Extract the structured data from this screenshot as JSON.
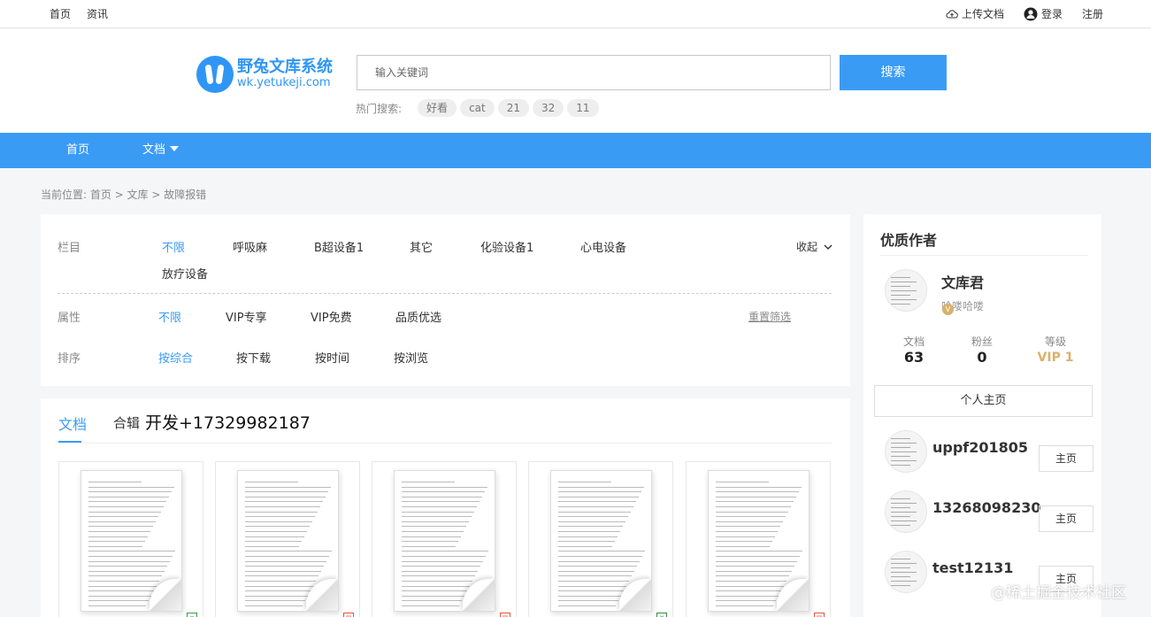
{
  "topbar": {
    "left_links": [
      "首页",
      "资讯"
    ],
    "upload": "上传文档",
    "login": "登录",
    "register": "注册"
  },
  "header": {
    "logo_title": "野兔文库系统",
    "logo_url": "wk.yetukeji.com",
    "search_placeholder": "输入关键词",
    "search_button": "搜索",
    "hot_label": "热门搜索:",
    "hot_tags": [
      "好看",
      "cat",
      "21",
      "32",
      "11"
    ]
  },
  "nav": {
    "home": "首页",
    "docs": "文档"
  },
  "breadcrumb": "当前位置:  首页 > 文库 > 故障报错",
  "filter": {
    "column_label": "栏目",
    "column_options": [
      "不限",
      "呼吸麻",
      "B超设备1",
      "其它",
      "化验设备1",
      "心电设备",
      "放疗设备"
    ],
    "collapse": "收起",
    "attr_label": "属性",
    "attr_options": [
      "不限",
      "VIP专享",
      "VIP免费",
      "品质优选"
    ],
    "reset": "重置筛选",
    "sort_label": "排序",
    "sort_options": [
      "按综合",
      "按下载",
      "按时间",
      "按浏览"
    ]
  },
  "docs": {
    "tab_docs": "文档",
    "tab_collection": "合辑",
    "tab_extra": "开发+17329982187",
    "file_types": [
      "doc-green",
      "ppt-red",
      "ppt-red",
      "xls-green",
      "ppt-red"
    ]
  },
  "sidebar": {
    "title": "优质作者",
    "author_name": "文库君",
    "author_desc": "哈喽哈喽",
    "vip_badge": "V",
    "stats": [
      {
        "label": "文档",
        "value": "63"
      },
      {
        "label": "粉丝",
        "value": "0"
      },
      {
        "label": "等级",
        "value": "VIP 1"
      }
    ],
    "homepage_button": "个人主页",
    "authors": [
      {
        "name": "uppf201805",
        "button": "主页"
      },
      {
        "name": "13268098230",
        "button": "主页"
      },
      {
        "name": "test12131",
        "button": "主页"
      }
    ]
  },
  "watermark": "@稀土掘金技术社区",
  "colors": {
    "accent": "#3a9bf5",
    "vip": "#d8b26a"
  }
}
